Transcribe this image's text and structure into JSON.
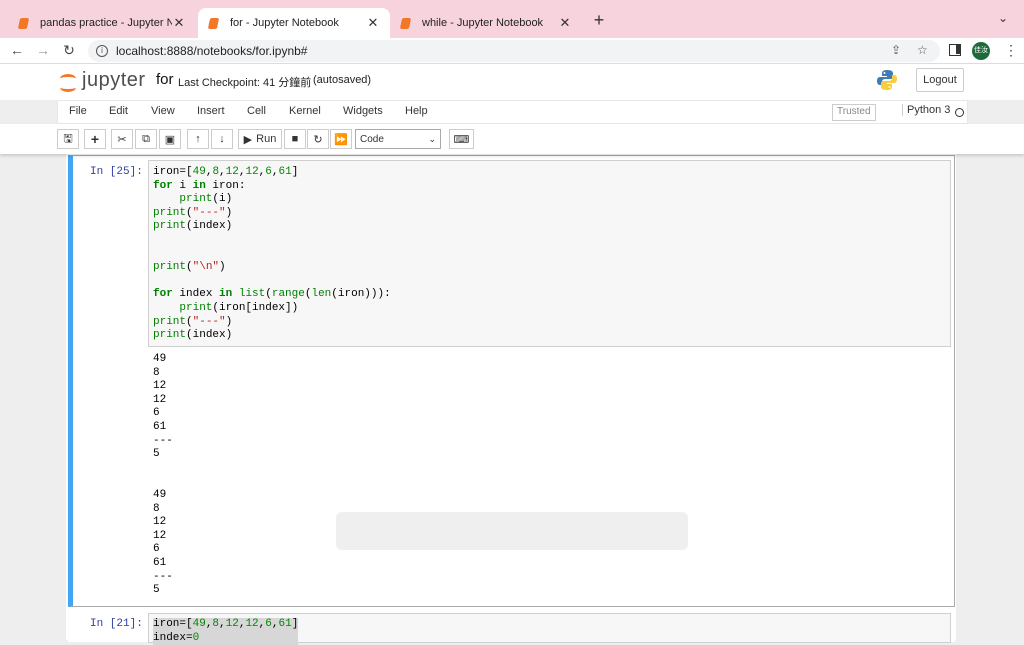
{
  "browser": {
    "tabs": [
      {
        "title": "pandas practice - Jupyter Note",
        "active": false
      },
      {
        "title": "for - Jupyter Notebook",
        "active": true
      },
      {
        "title": "while - Jupyter Notebook",
        "active": false
      }
    ],
    "url": "localhost:8888/notebooks/for.ipynb#",
    "avatar_text": "佳汝"
  },
  "jupyter": {
    "logo_text": "jupyter",
    "notebook_name": "for",
    "checkpoint": "Last Checkpoint: 41 分鐘前",
    "autosaved": "(autosaved)",
    "logout": "Logout",
    "menu": [
      "File",
      "Edit",
      "View",
      "Insert",
      "Cell",
      "Kernel",
      "Widgets",
      "Help"
    ],
    "trusted": "Trusted",
    "kernel": "Python 3",
    "toolbar": {
      "run": "Run",
      "cell_type": "Code"
    }
  },
  "cells": [
    {
      "prompt": "In [25]:",
      "output": "49\n8\n12\n12\n6\n61\n---\n5\n\n\n49\n8\n12\n12\n6\n61\n---\n5"
    },
    {
      "prompt": "In [21]:"
    }
  ],
  "colors": {
    "accent": "#f37726",
    "prompt": "#303f9f",
    "selected_border": "#42a5f5"
  }
}
